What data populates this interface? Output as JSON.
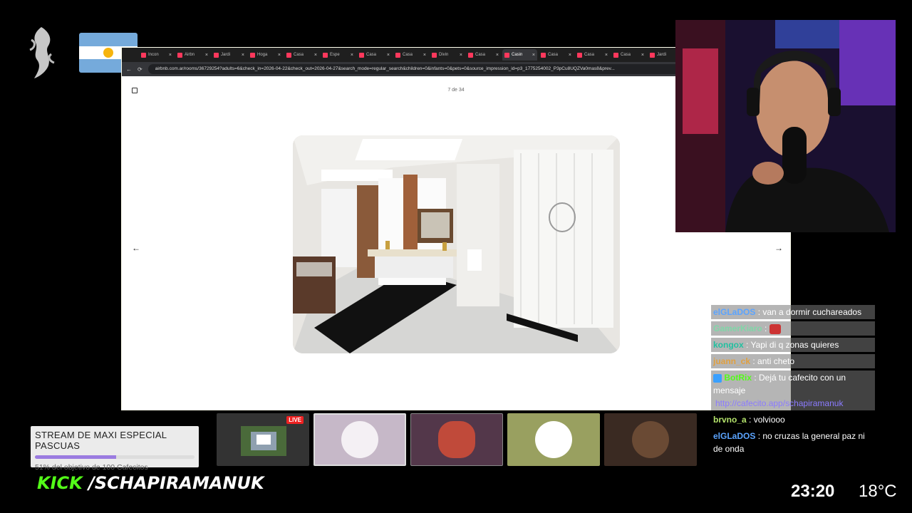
{
  "browser": {
    "tabs": [
      {
        "label": "Incon"
      },
      {
        "label": "Airbn"
      },
      {
        "label": "Jardi"
      },
      {
        "label": "Hoga"
      },
      {
        "label": "Casa"
      },
      {
        "label": "Espe"
      },
      {
        "label": "Casa"
      },
      {
        "label": "Casa"
      },
      {
        "label": "Divin"
      },
      {
        "label": "Casa"
      },
      {
        "label": "Casin"
      },
      {
        "label": "Casa"
      },
      {
        "label": "Casa"
      },
      {
        "label": "Casa"
      },
      {
        "label": "Jardi"
      }
    ],
    "active_tab": 10,
    "url": "airbnb.com.ar/rooms/36729254?adults=6&check_in=2026-04-22&check_out=2026-04-27&search_mode=regular_search&children=0&infants=0&pets=0&source_impression_id=p3_1775254002_P3pCu8UQZVa0mas8&prev...",
    "photo_counter": "7 de 34"
  },
  "chat": [
    {
      "user": "elGLaDOS",
      "color": "#5ba4ff",
      "text": ": van a dormir cuchareados",
      "boxed": true
    },
    {
      "user": "GamerKiaro",
      "color": "#7fd7a8",
      "text": ":",
      "emote": "devil-emote",
      "boxed": true
    },
    {
      "user": "kongox",
      "color": "#22c0a0",
      "text": ": Yapi di q zonas quieres",
      "boxed": true
    },
    {
      "user": "juann_ck",
      "color": "#e0a040",
      "text": ": anti cheto",
      "boxed": true
    },
    {
      "user": "BotRix",
      "color": "#53fc18",
      "text": ": Dejá tu cafecito con un mensaje",
      "boxed": true,
      "bot": true,
      "link": "http://cafecito.app/schapiramanuk"
    },
    {
      "user": "brvno_a",
      "color": "#b4e36b",
      "text": ": volviooo",
      "boxed": false
    },
    {
      "user": "elGLaDOS",
      "color": "#5ba4ff",
      "text": ": no cruzas la general paz ni de onda",
      "boxed": false
    }
  ],
  "goal": {
    "title": "STREAM DE MAXI ESPECIAL PASCUAS",
    "progress": 0.51,
    "subtitle": "51% del objetivo de 100 Cafecitos"
  },
  "thumbnails": {
    "live_badge": "LIVE"
  },
  "channel": {
    "platform": "KICK",
    "handle": "/SCHAPIRAMANUK"
  },
  "status": {
    "time": "23:20",
    "temperature": "18°C"
  }
}
